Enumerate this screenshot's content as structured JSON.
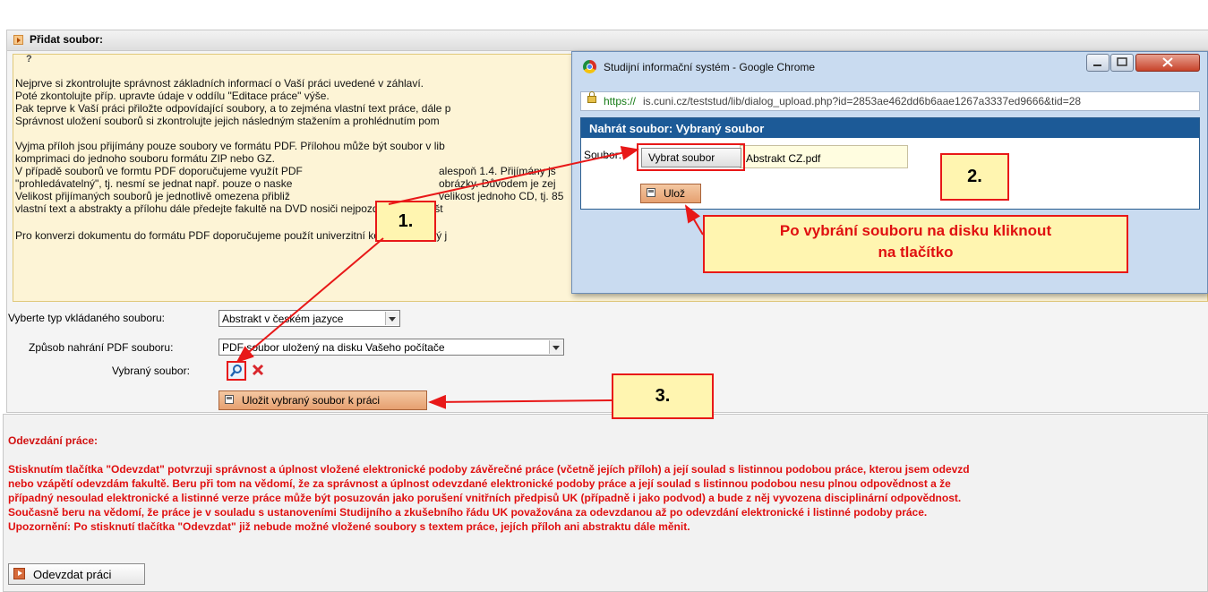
{
  "upload_section": {
    "title": "Přidat soubor:",
    "help_icon": "?",
    "help_lines": [
      "Nejprve si zkontrolujte správnost základních informací o Vaší práci uvedené v záhlaví.",
      "Poté zkontolujte příp. upravte údaje v oddílu \"Editace práce\" výše.",
      "Pak teprve k Vaší práci přiložte odpovídající soubory, a to zejména vlastní text práce, dále p",
      "Správnost uložení souborů si zkontrolujte jejich následným stažením a prohlédnutím pom",
      "",
      "Vyjma příloh jsou přijímány pouze soubory ve formátu PDF. Přílohou může být soubor v lib",
      "komprimaci do jednoho souboru formátu ZIP nebo GZ.",
      "V případě souborů ve formtu PDF doporučujeme využít PDF",
      "\"prohledávatelný\", tj. nesmí se jednat např. pouze o naske",
      "Velikost přijímaných souborů je jednotlivě omezena přibliž",
      "vlastní text a abstrakty a přílohu dále předejte fakultě na DVD nosiči nejpozději spolu s tišt",
      "",
      "Pro konverzi dokumentu do formátu PDF doporučujeme použít univerzitní konvertor, který j"
    ],
    "help_frag_1": "alespoň 1.4. Přijímány js",
    "help_frag_2": "obrázky. Důvodem je zej",
    "help_frag_3": "velikost jednoho CD, tj. 85",
    "file_type_label": "Vyberte typ vkládaného souboru:",
    "file_type_value": "Abstrakt v českém jazyce",
    "upload_method_label": "Způsob nahrání PDF souboru:",
    "upload_method_value": "PDF soubor uložený na disku Vašeho počítače",
    "selected_file_label": "Vybraný soubor:",
    "save_button": "Uložit vybraný soubor k práci"
  },
  "popup": {
    "window_title": "Studijní informační systém - Google Chrome",
    "url_scheme": "https://",
    "url_rest": "is.cuni.cz/teststud/lib/dialog_upload.php?id=2853ae462dd6b6aae1267a3337ed9666&tid=28",
    "dialog_title": "Nahrát soubor: Vybraný soubor",
    "file_label": "Soubor:",
    "choose_button": "Vybrat soubor",
    "file_name": "Abstrakt CZ.pdf",
    "save_button": "Ulož"
  },
  "annotations": {
    "step1": "1.",
    "step2": "2.",
    "step3": "3.",
    "callout_line1": "Po vybrání souboru na disku kliknout",
    "callout_line2": "na tlačítko"
  },
  "submission": {
    "title": "Odevzdání práce:",
    "lines": [
      "Stisknutím tlačítka \"Odevzdat\" potvrzuji správnost a úplnost vložené elektronické podoby závěrečné práce (včetně jejích příloh) a její soulad s listinnou podobou práce, kterou jsem odevzd",
      "nebo vzápětí odevzdám fakultě. Beru při tom na vědomí, že za správnost a úplnost odevzdané elektronické podoby práce a její soulad s listinnou podobou nesu plnou odpovědnost a že",
      "případný nesoulad elektronické a listinné verze práce může být posuzován jako porušení vnitřních předpisů UK (případně i jako podvod) a bude z něj vyvozena disciplinární odpovědnost.",
      "Současně beru na vědomí, že práce je v souladu s ustanoveními Studijního a zkušebního řádu UK považována za odevzdanou až po odevzdání elektronické i listinné podoby práce.",
      "Upozornění: Po stisknutí tlačítka \"Odevzdat\" již nebude možné vložené soubory s textem práce, jejích příloh ani abstraktu dále měnit."
    ],
    "submit_button": "Odevzdat práci"
  },
  "colors": {
    "accent_red": "#e81818",
    "dialog_header": "#1c5a97",
    "help_background": "#fdf4d6",
    "callout_background": "#fff5b0"
  }
}
